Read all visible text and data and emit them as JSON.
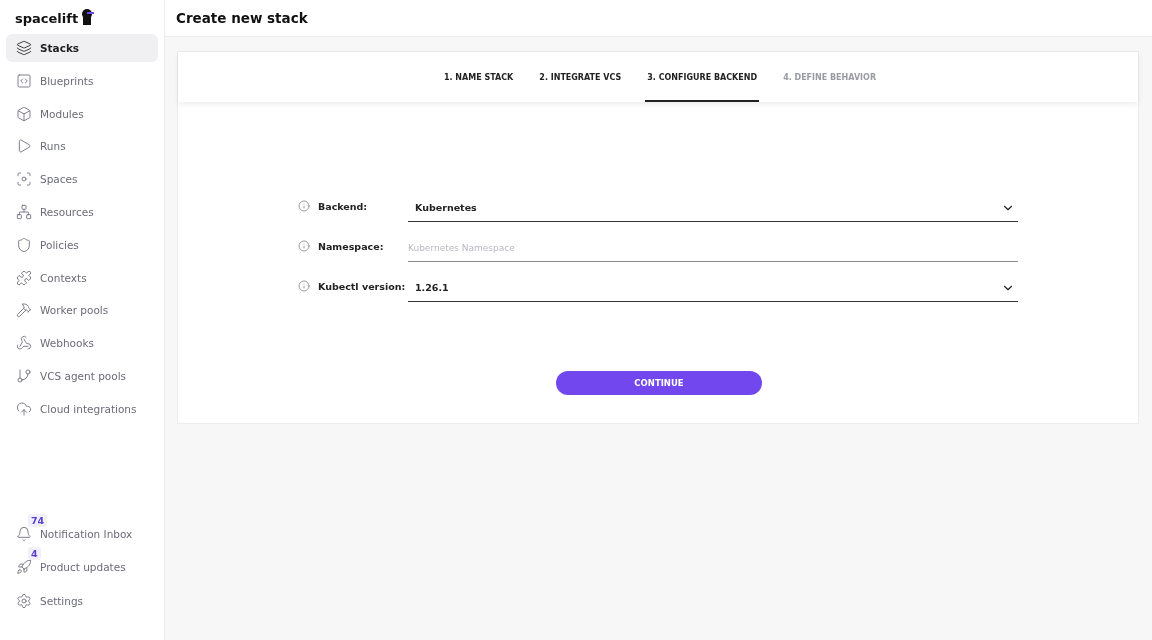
{
  "sidebar": {
    "logo": "spacelift",
    "items": [
      {
        "label": "Stacks",
        "selected": true
      },
      {
        "label": "Blueprints",
        "selected": false
      },
      {
        "label": "Modules",
        "selected": false
      },
      {
        "label": "Runs",
        "selected": false
      },
      {
        "label": "Spaces",
        "selected": false
      },
      {
        "label": "Resources",
        "selected": false
      },
      {
        "label": "Policies",
        "selected": false
      },
      {
        "label": "Contexts",
        "selected": false
      },
      {
        "label": "Worker pools",
        "selected": false
      },
      {
        "label": "Webhooks",
        "selected": false
      },
      {
        "label": "VCS agent pools",
        "selected": false
      },
      {
        "label": "Cloud integrations",
        "selected": false
      }
    ],
    "bottom_items": [
      {
        "label": "Notification Inbox",
        "badge": "74",
        "selected": false
      },
      {
        "label": "Product updates",
        "badge": "4",
        "selected": false
      },
      {
        "label": "Settings",
        "selected": false
      }
    ]
  },
  "page": {
    "title": "Create new stack"
  },
  "steps": [
    {
      "label": "1. NAME STACK",
      "selected": false,
      "disabled": false
    },
    {
      "label": "2. INTEGRATE VCS",
      "selected": false,
      "disabled": false
    },
    {
      "label": "3. CONFIGURE BACKEND",
      "selected": true,
      "disabled": false
    },
    {
      "label": "4. DEFINE BEHAVIOR",
      "selected": false,
      "disabled": true
    }
  ],
  "fields": [
    {
      "kind": "select",
      "label": "Backend:",
      "value": "Kubernetes"
    },
    {
      "kind": "text",
      "label": "Namespace:",
      "placeholder": "Kubernetes Namespace"
    },
    {
      "kind": "select",
      "label": "Kubectl version:",
      "value": "1.26.1"
    }
  ],
  "continue_button": "CONTINUE"
}
